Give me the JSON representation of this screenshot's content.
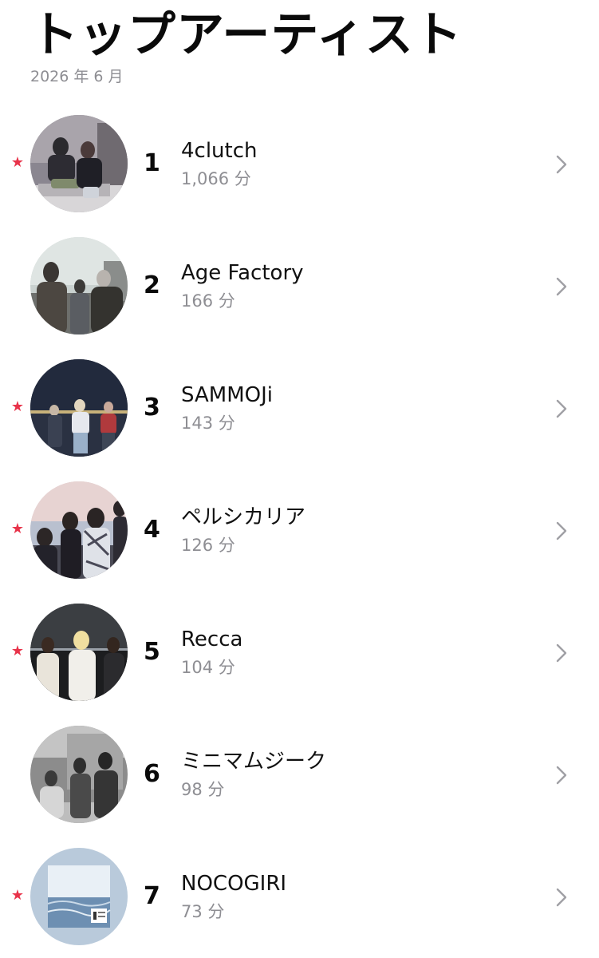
{
  "header": {
    "title": "トップアーティスト",
    "subtitle": "2026 年 6 月"
  },
  "colors": {
    "favorite_star": "#e8334a",
    "secondary_text": "#8e8e93",
    "chevron": "#a0a0a5"
  },
  "icons": {
    "favorite": "star-icon",
    "disclosure": "chevron-right-icon"
  },
  "artists": [
    {
      "rank": "1",
      "name": "4clutch",
      "minutes": "1,066 分",
      "favorite": true,
      "star": "★"
    },
    {
      "rank": "2",
      "name": "Age Factory",
      "minutes": "166 分",
      "favorite": false,
      "star": ""
    },
    {
      "rank": "3",
      "name": "SAMMOJi",
      "minutes": "143 分",
      "favorite": true,
      "star": "★"
    },
    {
      "rank": "4",
      "name": "ペルシカリア",
      "minutes": "126 分",
      "favorite": true,
      "star": "★"
    },
    {
      "rank": "5",
      "name": "Recca",
      "minutes": "104 分",
      "favorite": true,
      "star": "★"
    },
    {
      "rank": "6",
      "name": "ミニマムジーク",
      "minutes": "98 分",
      "favorite": false,
      "star": ""
    },
    {
      "rank": "7",
      "name": "NOCOGIRI",
      "minutes": "73 分",
      "favorite": true,
      "star": "★"
    }
  ]
}
